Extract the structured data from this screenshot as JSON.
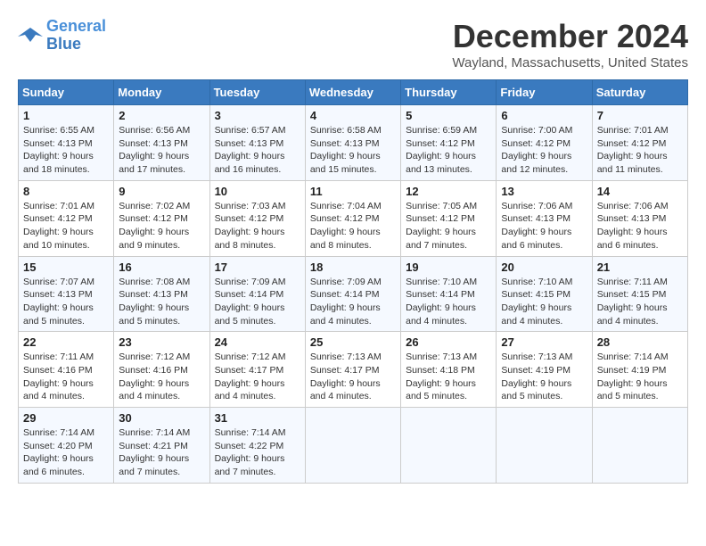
{
  "logo": {
    "line1": "General",
    "line2": "Blue"
  },
  "title": "December 2024",
  "location": "Wayland, Massachusetts, United States",
  "header_days": [
    "Sunday",
    "Monday",
    "Tuesday",
    "Wednesday",
    "Thursday",
    "Friday",
    "Saturday"
  ],
  "weeks": [
    [
      {
        "day": 1,
        "sunrise": "6:55 AM",
        "sunset": "4:13 PM",
        "daylight": "9 hours and 18 minutes."
      },
      {
        "day": 2,
        "sunrise": "6:56 AM",
        "sunset": "4:13 PM",
        "daylight": "9 hours and 17 minutes."
      },
      {
        "day": 3,
        "sunrise": "6:57 AM",
        "sunset": "4:13 PM",
        "daylight": "9 hours and 16 minutes."
      },
      {
        "day": 4,
        "sunrise": "6:58 AM",
        "sunset": "4:13 PM",
        "daylight": "9 hours and 15 minutes."
      },
      {
        "day": 5,
        "sunrise": "6:59 AM",
        "sunset": "4:12 PM",
        "daylight": "9 hours and 13 minutes."
      },
      {
        "day": 6,
        "sunrise": "7:00 AM",
        "sunset": "4:12 PM",
        "daylight": "9 hours and 12 minutes."
      },
      {
        "day": 7,
        "sunrise": "7:01 AM",
        "sunset": "4:12 PM",
        "daylight": "9 hours and 11 minutes."
      }
    ],
    [
      {
        "day": 8,
        "sunrise": "7:01 AM",
        "sunset": "4:12 PM",
        "daylight": "9 hours and 10 minutes."
      },
      {
        "day": 9,
        "sunrise": "7:02 AM",
        "sunset": "4:12 PM",
        "daylight": "9 hours and 9 minutes."
      },
      {
        "day": 10,
        "sunrise": "7:03 AM",
        "sunset": "4:12 PM",
        "daylight": "9 hours and 8 minutes."
      },
      {
        "day": 11,
        "sunrise": "7:04 AM",
        "sunset": "4:12 PM",
        "daylight": "9 hours and 8 minutes."
      },
      {
        "day": 12,
        "sunrise": "7:05 AM",
        "sunset": "4:12 PM",
        "daylight": "9 hours and 7 minutes."
      },
      {
        "day": 13,
        "sunrise": "7:06 AM",
        "sunset": "4:13 PM",
        "daylight": "9 hours and 6 minutes."
      },
      {
        "day": 14,
        "sunrise": "7:06 AM",
        "sunset": "4:13 PM",
        "daylight": "9 hours and 6 minutes."
      }
    ],
    [
      {
        "day": 15,
        "sunrise": "7:07 AM",
        "sunset": "4:13 PM",
        "daylight": "9 hours and 5 minutes."
      },
      {
        "day": 16,
        "sunrise": "7:08 AM",
        "sunset": "4:13 PM",
        "daylight": "9 hours and 5 minutes."
      },
      {
        "day": 17,
        "sunrise": "7:09 AM",
        "sunset": "4:14 PM",
        "daylight": "9 hours and 5 minutes."
      },
      {
        "day": 18,
        "sunrise": "7:09 AM",
        "sunset": "4:14 PM",
        "daylight": "9 hours and 4 minutes."
      },
      {
        "day": 19,
        "sunrise": "7:10 AM",
        "sunset": "4:14 PM",
        "daylight": "9 hours and 4 minutes."
      },
      {
        "day": 20,
        "sunrise": "7:10 AM",
        "sunset": "4:15 PM",
        "daylight": "9 hours and 4 minutes."
      },
      {
        "day": 21,
        "sunrise": "7:11 AM",
        "sunset": "4:15 PM",
        "daylight": "9 hours and 4 minutes."
      }
    ],
    [
      {
        "day": 22,
        "sunrise": "7:11 AM",
        "sunset": "4:16 PM",
        "daylight": "9 hours and 4 minutes."
      },
      {
        "day": 23,
        "sunrise": "7:12 AM",
        "sunset": "4:16 PM",
        "daylight": "9 hours and 4 minutes."
      },
      {
        "day": 24,
        "sunrise": "7:12 AM",
        "sunset": "4:17 PM",
        "daylight": "9 hours and 4 minutes."
      },
      {
        "day": 25,
        "sunrise": "7:13 AM",
        "sunset": "4:17 PM",
        "daylight": "9 hours and 4 minutes."
      },
      {
        "day": 26,
        "sunrise": "7:13 AM",
        "sunset": "4:18 PM",
        "daylight": "9 hours and 5 minutes."
      },
      {
        "day": 27,
        "sunrise": "7:13 AM",
        "sunset": "4:19 PM",
        "daylight": "9 hours and 5 minutes."
      },
      {
        "day": 28,
        "sunrise": "7:14 AM",
        "sunset": "4:19 PM",
        "daylight": "9 hours and 5 minutes."
      }
    ],
    [
      {
        "day": 29,
        "sunrise": "7:14 AM",
        "sunset": "4:20 PM",
        "daylight": "9 hours and 6 minutes."
      },
      {
        "day": 30,
        "sunrise": "7:14 AM",
        "sunset": "4:21 PM",
        "daylight": "9 hours and 7 minutes."
      },
      {
        "day": 31,
        "sunrise": "7:14 AM",
        "sunset": "4:22 PM",
        "daylight": "9 hours and 7 minutes."
      },
      null,
      null,
      null,
      null
    ]
  ]
}
